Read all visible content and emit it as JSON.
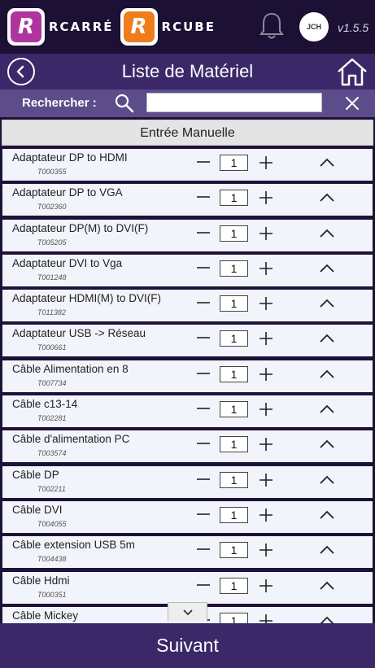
{
  "brand": {
    "logo1_letter": "R",
    "logo1_text": "RCARRÉ",
    "logo2_letter": "R",
    "logo2_text": "RCUBE",
    "avatar_initials": "JCH",
    "version": "v1.5.5",
    "colors": {
      "logo1": "#b0349f",
      "logo2": "#f07d1c"
    }
  },
  "header": {
    "title": "Liste de Matériel"
  },
  "search": {
    "label": "Rechercher :",
    "value": "",
    "placeholder": ""
  },
  "list": {
    "section_header": "Entrée Manuelle",
    "items": [
      {
        "name": "Adaptateur DP to HDMI",
        "code": "T000355",
        "qty": "1"
      },
      {
        "name": "Adaptateur DP to VGA",
        "code": "T002360",
        "qty": "1"
      },
      {
        "name": "Adaptateur DP(M) to DVI(F)",
        "code": "T005205",
        "qty": "1"
      },
      {
        "name": "Adaptateur DVI to Vga",
        "code": "T001248",
        "qty": "1"
      },
      {
        "name": "Adaptateur HDMI(M) to DVI(F)",
        "code": "T011382",
        "qty": "1"
      },
      {
        "name": "Adaptateur USB ->  Réseau",
        "code": "T000661",
        "qty": "1"
      },
      {
        "name": "Câble Alimentation en 8",
        "code": "T007734",
        "qty": "1"
      },
      {
        "name": "Câble c13-14",
        "code": "T002281",
        "qty": "1"
      },
      {
        "name": "Câble d'alimentation PC",
        "code": "T003574",
        "qty": "1"
      },
      {
        "name": "Câble DP",
        "code": "T002211",
        "qty": "1"
      },
      {
        "name": "Câble DVI",
        "code": "T004055",
        "qty": "1"
      },
      {
        "name": "Câble extension USB 5m",
        "code": "T004438",
        "qty": "1"
      },
      {
        "name": "Câble Hdmi",
        "code": "T000351",
        "qty": "1"
      },
      {
        "name": "Câble Mickey",
        "code": "",
        "qty": "1"
      }
    ]
  },
  "footer": {
    "next_label": "Suivant"
  },
  "icons": [
    "back-icon",
    "home-icon",
    "search-icon",
    "close-icon",
    "bell-icon",
    "minus-icon",
    "plus-icon",
    "chevron-up-icon",
    "chevron-down-icon"
  ]
}
